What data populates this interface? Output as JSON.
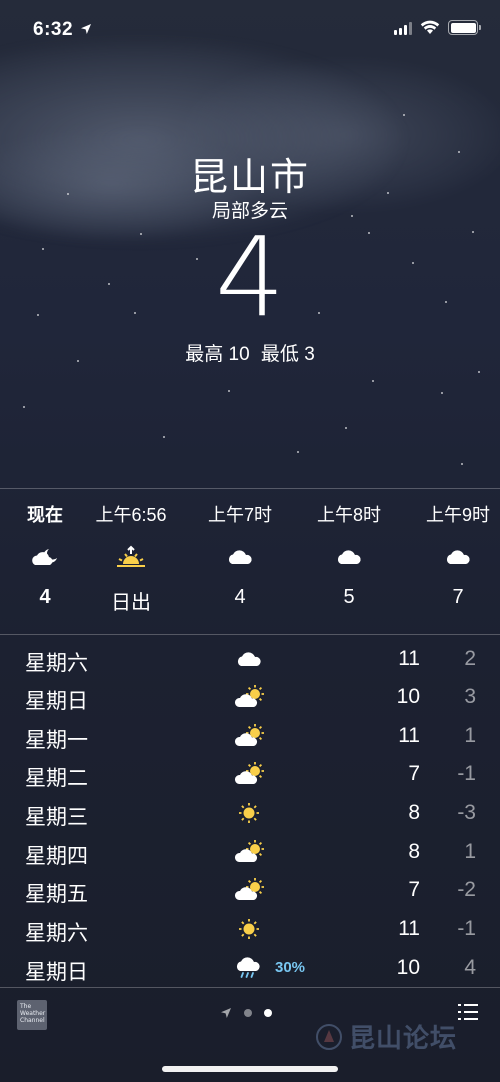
{
  "status_bar": {
    "time": "6:32"
  },
  "current": {
    "city": "昆山市",
    "condition": "局部多云",
    "temperature": "4",
    "high": "最高 10",
    "low": "最低 3"
  },
  "hourly": [
    {
      "label": "现在",
      "icon": "partly-cloudy-night-icon",
      "temp": "4"
    },
    {
      "label": "上午6:56",
      "icon": "sunrise-icon",
      "temp": "日出"
    },
    {
      "label": "上午7时",
      "icon": "cloud-icon",
      "temp": "4"
    },
    {
      "label": "上午8时",
      "icon": "cloud-icon",
      "temp": "5"
    },
    {
      "label": "上午9时",
      "icon": "cloud-icon",
      "temp": "7"
    }
  ],
  "daily": [
    {
      "day": "星期六",
      "icon": "cloud-icon",
      "precip": "",
      "high": "11",
      "low": "2"
    },
    {
      "day": "星期日",
      "icon": "partly-sunny-icon",
      "precip": "",
      "high": "10",
      "low": "3"
    },
    {
      "day": "星期一",
      "icon": "partly-sunny-icon",
      "precip": "",
      "high": "11",
      "low": "1"
    },
    {
      "day": "星期二",
      "icon": "partly-sunny-icon",
      "precip": "",
      "high": "7",
      "low": "-1"
    },
    {
      "day": "星期三",
      "icon": "sun-icon",
      "precip": "",
      "high": "8",
      "low": "-3"
    },
    {
      "day": "星期四",
      "icon": "partly-sunny-icon",
      "precip": "",
      "high": "8",
      "low": "1"
    },
    {
      "day": "星期五",
      "icon": "partly-sunny-icon",
      "precip": "",
      "high": "7",
      "low": "-2"
    },
    {
      "day": "星期六",
      "icon": "sun-icon",
      "precip": "",
      "high": "11",
      "low": "-1"
    },
    {
      "day": "星期日",
      "icon": "rain-icon",
      "precip": "30%",
      "high": "10",
      "low": "4"
    }
  ],
  "footer": {
    "logo_text": "The Weather Channel",
    "watermark": "昆山论坛",
    "page_count": 3,
    "active_page": 2
  },
  "colors": {
    "precip": "#78c6f0",
    "background_top": "#252b3a",
    "background_bottom": "#1a1e2b"
  }
}
